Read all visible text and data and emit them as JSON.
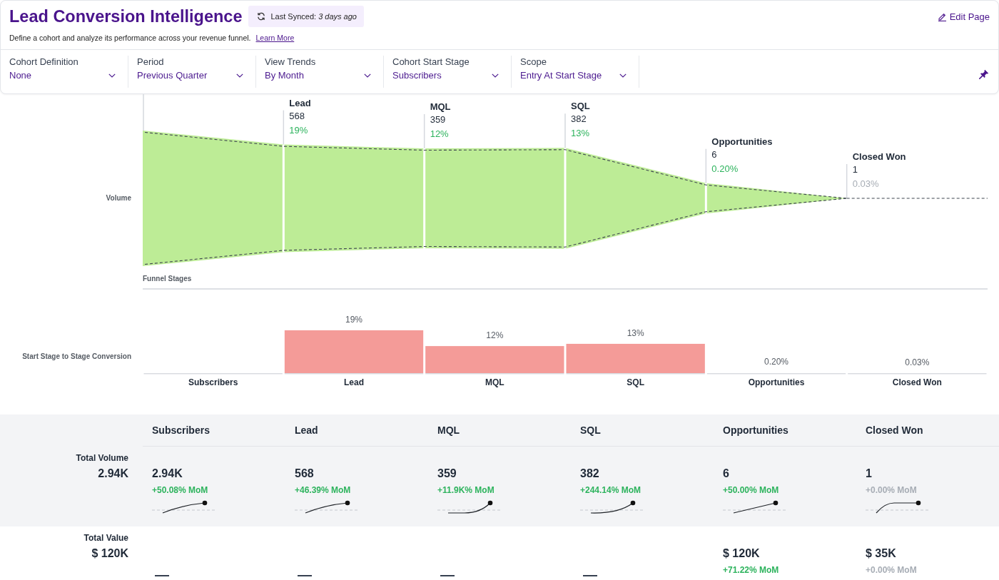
{
  "header": {
    "title": "Lead Conversion Intelligence",
    "sync_status": "Last Synced: *3 days ago*",
    "edit_link": "Edit Page",
    "description": "Define a cohort and analyze its performance across your revenue funnel.",
    "learn_more_link": "Learn More"
  },
  "filters": [
    {
      "label": "Cohort Definition",
      "value": "None"
    },
    {
      "label": "Period",
      "value": "Previous Quarter"
    },
    {
      "label": "View Trends",
      "value": "By Month"
    },
    {
      "label": "Cohort Start Stage",
      "value": "Subscribers"
    },
    {
      "label": "Scope",
      "value": "Entry At Start Stage"
    }
  ],
  "funnel": {
    "ylabel": "Volume",
    "xlabel": "Funnel Stages",
    "stages": [
      {
        "name": "Lead",
        "count": "568",
        "rate": "19%",
        "muted": false
      },
      {
        "name": "MQL",
        "count": "359",
        "rate": "12%",
        "muted": false
      },
      {
        "name": "SQL",
        "count": "382",
        "rate": "13%",
        "muted": false
      },
      {
        "name": "Opportunities",
        "count": "6",
        "rate": "0.20%",
        "muted": false
      },
      {
        "name": "Closed Won",
        "count": "1",
        "rate": "0.03%",
        "muted": true
      }
    ]
  },
  "conversion": {
    "chart_data": {
      "type": "bar",
      "ylabel": "Start Stage to Stage Conversion",
      "categories": [
        "Subscribers",
        "Lead",
        "MQL",
        "SQL",
        "Opportunities",
        "Closed Won"
      ],
      "values": [
        null,
        19,
        12,
        13,
        0.2,
        0.03
      ],
      "value_labels": [
        null,
        "19%",
        "12%",
        "13%",
        "0.20%",
        "0.03%"
      ]
    }
  },
  "metrics": {
    "columns": [
      "Subscribers",
      "Lead",
      "MQL",
      "SQL",
      "Opportunities",
      "Closed Won"
    ],
    "rows": [
      {
        "label": "Total Volume",
        "total": "2.94K",
        "cells": [
          {
            "kind": "decelerating",
            "value": "2.94K",
            "change": "+50.08% MoM",
            "muted": false
          },
          {
            "kind": "decelerating",
            "value": "568",
            "change": "+46.39% MoM",
            "muted": false
          },
          {
            "kind": "delayed",
            "value": "359",
            "change": "+11.9K% MoM",
            "muted": false
          },
          {
            "kind": "accelerating",
            "value": "382",
            "change": "+244.14% MoM",
            "muted": false
          },
          {
            "kind": "linear",
            "value": "6",
            "change": "+50.00% MoM",
            "muted": false
          },
          {
            "kind": "plateau",
            "value": "1",
            "change": "+0.00% MoM",
            "muted": true
          }
        ]
      },
      {
        "label": "Total Value",
        "total": "$ 120K",
        "cells": [
          {
            "kind": "empty"
          },
          {
            "kind": "empty"
          },
          {
            "kind": "empty"
          },
          {
            "kind": "empty"
          },
          {
            "kind": "plain",
            "value": "$ 120K",
            "change": "+71.22% MoM",
            "muted": false
          },
          {
            "kind": "plain",
            "value": "$ 35K",
            "change": "+0.00% MoM",
            "muted": true
          }
        ]
      }
    ]
  }
}
